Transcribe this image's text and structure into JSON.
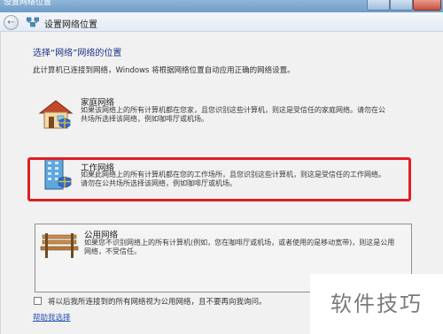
{
  "window": {
    "title": "设置网络位置"
  },
  "nav": {
    "back_glyph": "←",
    "title": "设置网络位置"
  },
  "page": {
    "heading": "选择“网络”网络的位置",
    "description": "此计算机已连接到网络，Windows 将根据网络位置自动应用正确的网络设置。"
  },
  "options": {
    "home": {
      "title": "家庭网络",
      "description": "如果该网络上的所有计算机都在您家，且您识别这些计算机，则这是受信任的家庭网络。请勿在公共场所选择该网络，例如咖啡厅或机场。"
    },
    "work": {
      "title": "工作网络",
      "description": "如果此网络上的所有计算机都在您的工作场所，且您识别这些计算机，则这是受信任的工作网络。请勿在公共场所选择该网络，例如咖啡厅或机场。"
    },
    "public": {
      "title": "公用网络",
      "description": "如果您不识别网络上的所有计算机(例如，您在咖啡厅或机场，或者使用的是移动宽带)，则这是公用网络，不受信任。"
    }
  },
  "checkbox": {
    "label": "将以后我所连接到的所有网络视为公用网络，且不要再向我询问。",
    "checked": false
  },
  "help_link": "帮助我选择",
  "watermark": "软件技巧",
  "colors": {
    "highlight": "#e41c25",
    "heading": "#1e3287",
    "link": "#2b55b5"
  }
}
